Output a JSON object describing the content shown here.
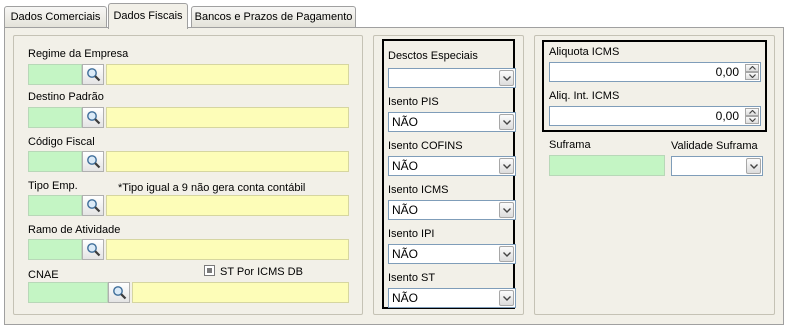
{
  "tabs": [
    {
      "label": "Dados Comerciais"
    },
    {
      "label": "Dados Fiscais"
    },
    {
      "label": "Bancos e Prazos de Pagamento"
    }
  ],
  "left": {
    "regime_label": "Regime da Empresa",
    "destino_label": "Destino Padrão",
    "codigo_label": "Código Fiscal",
    "tipo_label": "Tipo Emp.",
    "tipo_note": "*Tipo igual a 9 não gera conta contábil",
    "ramo_label": "Ramo de Atividade",
    "cnae_label": "CNAE",
    "st_label": "ST Por ICMS DB"
  },
  "middle": {
    "desctos_label": "Desctos Especiais",
    "desctos_value": "",
    "pis_label": "Isento PIS",
    "pis_value": "NÃO",
    "cofins_label": "Isento COFINS",
    "cofins_value": "NÃO",
    "icms_label": "Isento ICMS",
    "icms_value": "NÃO",
    "ipi_label": "Isento IPI",
    "ipi_value": "NÃO",
    "st_label": "Isento ST",
    "st_value": "NÃO"
  },
  "right": {
    "aliquota_label": "Aliquota ICMS",
    "aliquota_value": "0,00",
    "aliq_int_label": "Aliq. Int. ICMS",
    "aliq_int_value": "0,00",
    "suframa_label": "Suframa",
    "validade_label": "Validade Suframa",
    "validade_value": ""
  },
  "colors": {
    "code_field": "#c4f5c4",
    "desc_field": "#fdfdb8",
    "panel_bg": "#f2f0e8"
  }
}
